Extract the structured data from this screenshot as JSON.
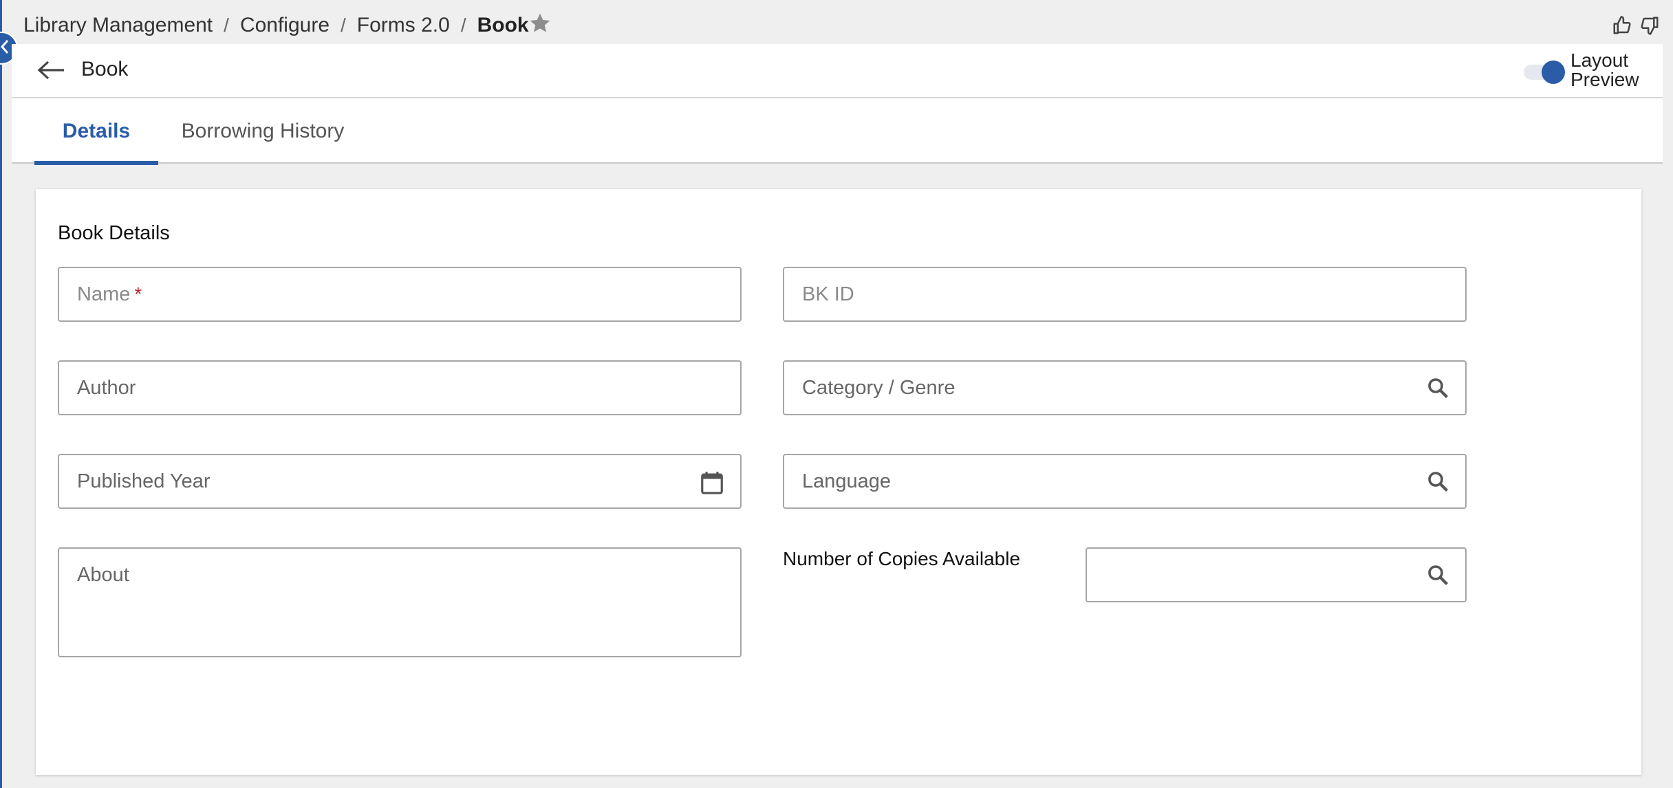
{
  "breadcrumb": {
    "items": [
      "Library Management",
      "Configure",
      "Forms 2.0"
    ],
    "current": "Book",
    "separator": "/"
  },
  "header": {
    "title": "Book",
    "layout_preview_label": "Layout Preview",
    "layout_preview_on": true
  },
  "tabs": [
    {
      "label": "Details",
      "active": true
    },
    {
      "label": "Borrowing History",
      "active": false
    }
  ],
  "form": {
    "section_title": "Book Details",
    "fields": {
      "name": {
        "label": "Name",
        "required_mark": "*"
      },
      "bk_id": {
        "label": "BK ID"
      },
      "author": {
        "label": "Author"
      },
      "category": {
        "label": "Category / Genre",
        "icon": "search-icon"
      },
      "published_year": {
        "label": "Published Year",
        "icon": "calendar-icon"
      },
      "language": {
        "label": "Language",
        "icon": "search-icon"
      },
      "about": {
        "label": "About"
      },
      "copies": {
        "label": "Number of Copies Available",
        "icon": "search-icon"
      }
    }
  },
  "colors": {
    "accent": "#2a5ca8",
    "required": "#c0272d",
    "background": "#eeefee"
  }
}
